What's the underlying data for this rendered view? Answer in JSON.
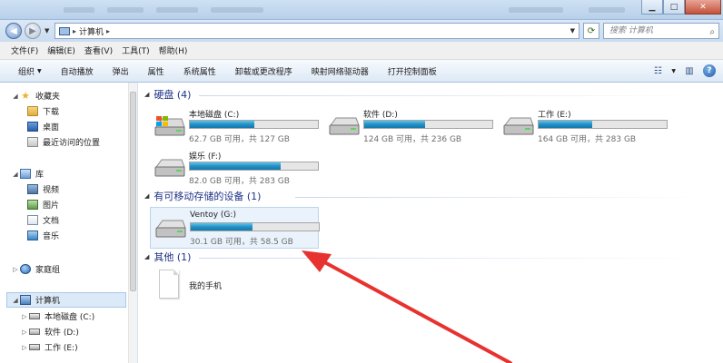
{
  "address": {
    "location": "计算机",
    "search_placeholder": "搜索 计算机"
  },
  "menu": [
    "文件(F)",
    "编辑(E)",
    "查看(V)",
    "工具(T)",
    "帮助(H)"
  ],
  "toolbar": [
    "组织",
    "自动播放",
    "弹出",
    "属性",
    "系统属性",
    "卸载或更改程序",
    "映射网络驱动器",
    "打开控制面板"
  ],
  "nav": {
    "favorites": "收藏夹",
    "downloads": "下载",
    "desktop": "桌面",
    "recent": "最近访问的位置",
    "libraries": "库",
    "videos": "视频",
    "pictures": "图片",
    "documents": "文档",
    "music": "音乐",
    "homegroup": "家庭组",
    "computer": "计算机",
    "drive_c": "本地磁盘 (C:)",
    "drive_d": "软件 (D:)",
    "drive_e": "工作 (E:)"
  },
  "groups": {
    "hard_disks": "硬盘 (4)",
    "removable": "有可移动存储的设备 (1)",
    "other": "其他 (1)"
  },
  "drives": {
    "c": {
      "name": "本地磁盘 (C:)",
      "info": "62.7 GB 可用，共 127 GB",
      "used_fraction": 0.506
    },
    "d": {
      "name": "软件 (D:)",
      "info": "124 GB 可用，共 236 GB",
      "used_fraction": 0.475
    },
    "e": {
      "name": "工作 (E:)",
      "info": "164 GB 可用，共 283 GB",
      "used_fraction": 0.42
    },
    "f": {
      "name": "娱乐 (F:)",
      "info": "82.0 GB 可用，共 283 GB",
      "used_fraction": 0.71
    },
    "g": {
      "name": "Ventoy (G:)",
      "info": "30.1 GB 可用，共 58.5 GB",
      "used_fraction": 0.485
    }
  },
  "other_device": "我的手机",
  "colors": {
    "group_header": "#1e3287",
    "bar_fill": "#2390c4",
    "annotation_arrow": "#e8322f"
  }
}
